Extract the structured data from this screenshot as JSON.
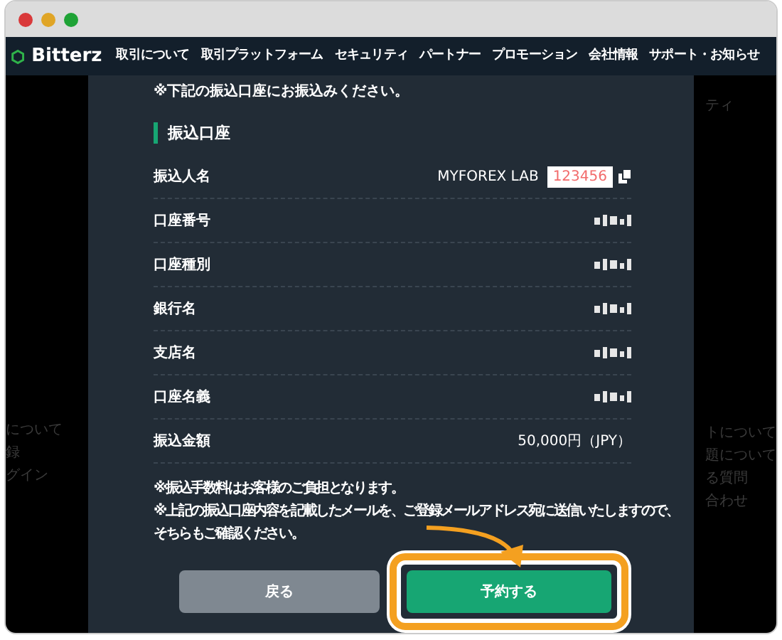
{
  "window": {
    "buttons": [
      {
        "color": "#d9393a"
      },
      {
        "color": "#e0a526"
      },
      {
        "color": "#1fa336"
      }
    ]
  },
  "navbar": {
    "brand": "Bitterz",
    "items": [
      "取引について",
      "取引プラットフォーム",
      "セキュリティ",
      "パートナー",
      "プロモーション",
      "会社情報",
      "サポート・お知らせ"
    ]
  },
  "background": {
    "top_right": "ティ",
    "left_links": [
      "について",
      "録",
      "グイン"
    ],
    "right_links": [
      "トについて",
      "題について",
      "る質問",
      "合わせ"
    ]
  },
  "modal": {
    "notice": "※下記の振込口座にお振込みください。",
    "section_title": "振込口座",
    "rows": [
      {
        "label": "振込人名",
        "kind": "name",
        "value": "MYFOREX LAB",
        "code": "123456"
      },
      {
        "label": "口座番号",
        "kind": "masked"
      },
      {
        "label": "口座種別",
        "kind": "masked"
      },
      {
        "label": "銀行名",
        "kind": "masked"
      },
      {
        "label": "支店名",
        "kind": "masked"
      },
      {
        "label": "口座名義",
        "kind": "masked"
      },
      {
        "label": "振込金額",
        "kind": "text",
        "value": "50,000円（JPY）"
      }
    ],
    "notes": [
      "※振込手数料はお客様のご負担となります。",
      "※上記の振込口座内容を記載したメールを、ご登録メールアドレス宛に送信いたしますので、そちらもご確認ください。"
    ],
    "buttons": [
      {
        "label": "戻る",
        "kind": "secondary",
        "highlighted": false
      },
      {
        "label": "予約する",
        "kind": "primary",
        "highlighted": true
      }
    ]
  }
}
